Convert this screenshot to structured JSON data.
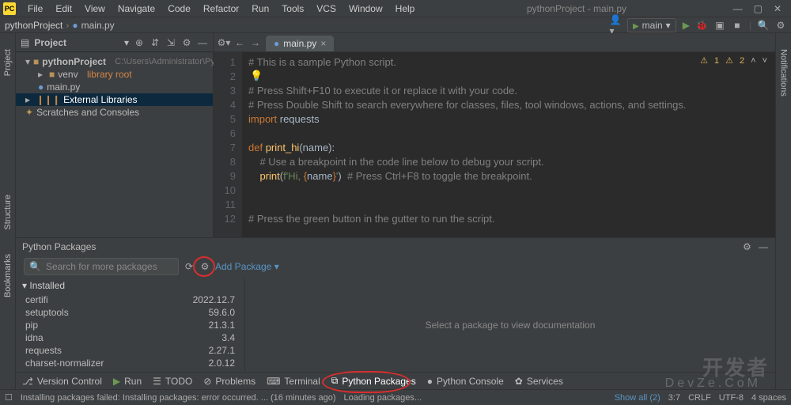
{
  "window": {
    "title": "pythonProject - main.py"
  },
  "menu": {
    "file": "File",
    "edit": "Edit",
    "view": "View",
    "navigate": "Navigate",
    "code": "Code",
    "refactor": "Refactor",
    "run": "Run",
    "tools": "Tools",
    "vcs": "VCS",
    "window": "Window",
    "help": "Help"
  },
  "crumb": {
    "project": "pythonProject",
    "file": "main.py"
  },
  "runconfig": {
    "name": "main"
  },
  "projectTool": {
    "title": "Project",
    "root": "pythonProject",
    "rootPath": "C:\\Users\\Administrator\\Pycharm",
    "venv": "venv",
    "venvHint": "library root",
    "mainpy": "main.py",
    "extlibs": "External Libraries",
    "scratches": "Scratches and Consoles"
  },
  "editorTab": {
    "name": "main.py"
  },
  "inspections": {
    "warn1": "1",
    "warn2": "2"
  },
  "code": {
    "l1": "# This is a sample Python script.",
    "l3": "# Press Shift+F10 to execute it or replace it with your code.",
    "l4": "# Press Double Shift to search everywhere for classes, files, tool windows, actions, and settings.",
    "l5_kw": "import",
    "l5_mod": "requests",
    "l7_def": "def ",
    "l7_fn": "print_hi",
    "l7_args": "(name):",
    "l8": "    # Use a breakpoint in the code line below to debug your script.",
    "l9_ind": "    ",
    "l9_fn": "print",
    "l9_a": "(",
    "l9_s1": "f'Hi, ",
    "l9_b": "{",
    "l9_v": "name",
    "l9_c": "}",
    "l9_s2": "'",
    "l9_d": ")",
    "l9_cmt": "  # Press Ctrl+F8 to toggle the breakpoint.",
    "l12": "# Press the green button in the gutter to run the script."
  },
  "gutters": [
    "1",
    "2",
    "3",
    "4",
    "5",
    "6",
    "7",
    "8",
    "9",
    "10",
    "11",
    "12"
  ],
  "pythonPackages": {
    "title": "Python Packages",
    "searchPlaceholder": "Search for more packages",
    "addPackage": "Add Package",
    "installedLabel": "Installed",
    "docHint": "Select a package to view documentation",
    "rows": [
      {
        "name": "certifi",
        "ver": "2022.12.7"
      },
      {
        "name": "setuptools",
        "ver": "59.6.0"
      },
      {
        "name": "pip",
        "ver": "21.3.1"
      },
      {
        "name": "idna",
        "ver": "3.4"
      },
      {
        "name": "requests",
        "ver": "2.27.1"
      },
      {
        "name": "charset-normalizer",
        "ver": "2.0.12"
      }
    ]
  },
  "bottomTabs": {
    "versionControl": "Version Control",
    "run": "Run",
    "todo": "TODO",
    "problems": "Problems",
    "terminal": "Terminal",
    "pythonPackages": "Python Packages",
    "pythonConsole": "Python Console",
    "services": "Services"
  },
  "status": {
    "msg": "Installing packages failed: Installing packages: error occurred. ... (16 minutes ago)",
    "loading": "Loading packages...",
    "showAll": "Show all (2)",
    "pos": "3:7",
    "eol": "CRLF",
    "enc": "UTF-8",
    "indent": "4 spaces"
  },
  "sideTabs": {
    "project": "Project",
    "structure": "Structure",
    "bookmarks": "Bookmarks",
    "notifications": "Notifications"
  },
  "watermark": "开发者",
  "watermark2": "DevZe.CoM"
}
